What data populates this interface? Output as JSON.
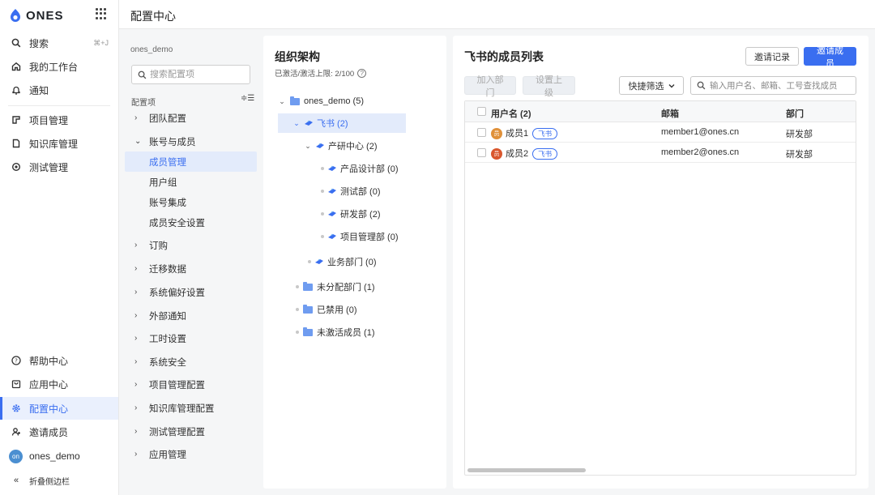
{
  "app": {
    "logo_text": "ONES"
  },
  "nav": {
    "top_items": [
      {
        "label": "搜索",
        "icon": "search-icon",
        "shortcut": "⌘+J"
      },
      {
        "label": "我的工作台",
        "icon": "home-icon"
      },
      {
        "label": "通知",
        "icon": "bell-icon"
      },
      {
        "label": "项目管理",
        "icon": "project-icon"
      },
      {
        "label": "知识库管理",
        "icon": "wiki-icon"
      },
      {
        "label": "测试管理",
        "icon": "testcase-icon"
      }
    ],
    "bottom_items": [
      {
        "label": "帮助中心",
        "icon": "help-icon"
      },
      {
        "label": "应用中心",
        "icon": "app-center-icon"
      },
      {
        "label": "配置中心",
        "icon": "gear-icon",
        "active": true
      },
      {
        "label": "邀请成员",
        "icon": "invite-icon"
      },
      {
        "label": "ones_demo",
        "icon": "avatar",
        "avatar_text": "on"
      },
      {
        "label": "折叠侧边栏",
        "icon": "collapse-icon"
      }
    ]
  },
  "header": {
    "title": "配置中心"
  },
  "config_menu": {
    "org_name": "ones_demo",
    "search_placeholder": "搜索配置项",
    "section_label": "配置项",
    "items": [
      {
        "label": "团队配置",
        "chevron": "›"
      },
      {
        "label": "账号与成员",
        "chevron": "⌄"
      },
      {
        "label": "成员管理",
        "sub": true,
        "active": true
      },
      {
        "label": "用户组",
        "sub": true
      },
      {
        "label": "账号集成",
        "sub": true
      },
      {
        "label": "成员安全设置",
        "sub": true
      },
      {
        "label": "订购",
        "chevron": "›"
      },
      {
        "label": "迁移数据",
        "chevron": "›"
      },
      {
        "label": "系统偏好设置",
        "chevron": "›"
      },
      {
        "label": "外部通知",
        "chevron": "›"
      },
      {
        "label": "工时设置",
        "chevron": "›"
      },
      {
        "label": "系统安全",
        "chevron": "›"
      },
      {
        "label": "项目管理配置",
        "chevron": "›"
      },
      {
        "label": "知识库管理配置",
        "chevron": "›"
      },
      {
        "label": "测试管理配置",
        "chevron": "›"
      },
      {
        "label": "应用管理",
        "chevron": "›"
      }
    ]
  },
  "org": {
    "title": "组织架构",
    "activation": "已激活/激活上限: 2/100",
    "help_glyph": "?",
    "tree": [
      {
        "label": "ones_demo (5)",
        "kind": "folder",
        "chevron": "⌄"
      },
      {
        "label": "飞书 (2)",
        "kind": "bird",
        "chevron": "⌄",
        "selected": true
      },
      {
        "label": "产研中心 (2)",
        "kind": "bird",
        "chevron": "⌄"
      },
      {
        "label": "产品设计部 (0)",
        "kind": "bird"
      },
      {
        "label": "测试部 (0)",
        "kind": "bird"
      },
      {
        "label": "研发部 (2)",
        "kind": "bird"
      },
      {
        "label": "项目管理部 (0)",
        "kind": "bird"
      },
      {
        "label": "业务部门 (0)",
        "kind": "bird"
      },
      {
        "label": "未分配部门 (1)",
        "kind": "folder"
      },
      {
        "label": "已禁用 (0)",
        "kind": "folder"
      },
      {
        "label": "未激活成员 (1)",
        "kind": "folder"
      }
    ]
  },
  "members": {
    "title": "飞书的成员列表",
    "invite_record_label": "邀请记录",
    "invite_member_label": "邀请成员",
    "add_dept_label": "加入部门",
    "set_manager_label": "设置上级",
    "quick_filter_label": "快捷筛选",
    "search_placeholder": "输入用户名、邮箱、工号查找成员",
    "columns": [
      "用户名 (2)",
      "邮箱",
      "部门"
    ],
    "rows": [
      {
        "name": "成员1",
        "avatar_text": "员",
        "avatar_color": "#e0913a",
        "tag": "飞书",
        "email": "member1@ones.cn",
        "dept": "研发部"
      },
      {
        "name": "成员2",
        "avatar_text": "员",
        "avatar_color": "#d9572e",
        "tag": "飞书",
        "email": "member2@ones.cn",
        "dept": "研发部"
      }
    ]
  },
  "colors": {
    "accent": "#3a6ef0",
    "nav_active_bg": "#eaf0fd",
    "folder": "#6f9cf0"
  }
}
